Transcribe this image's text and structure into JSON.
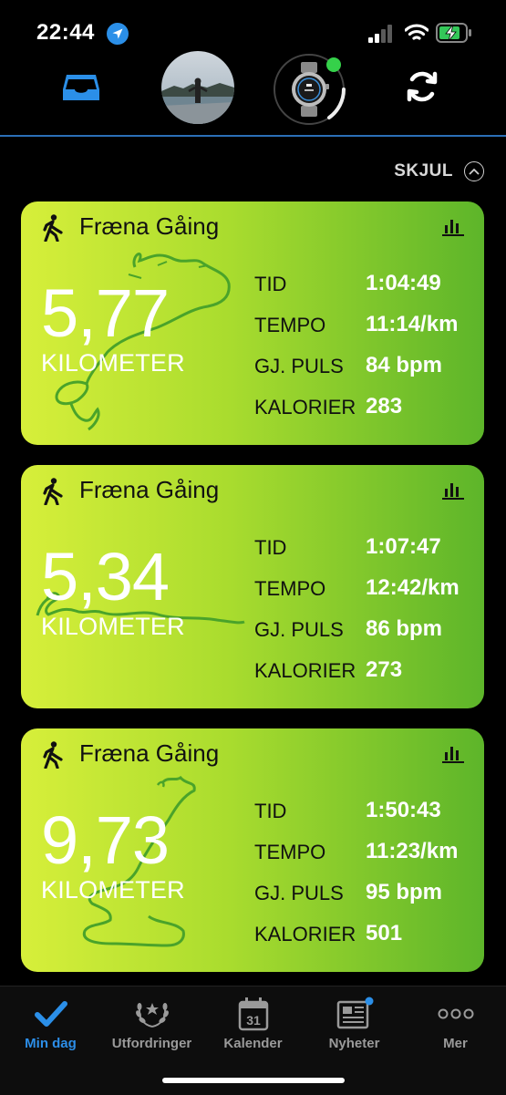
{
  "status_bar": {
    "time": "22:44",
    "battery_color": "#34c759"
  },
  "header": {
    "inbox_icon": "inbox-icon",
    "sync_icon": "sync-icon",
    "accent": "#2b8fe8",
    "watch_status_color": "#35d14a"
  },
  "hide_toggle": {
    "label": "SKJUL"
  },
  "activities": [
    {
      "title": "Fræna Gåing",
      "distance": "5,77",
      "unit": "KILOMETER",
      "stats": [
        {
          "label": "TID",
          "value": "1:04:49"
        },
        {
          "label": "TEMPO",
          "value": "11:14/km"
        },
        {
          "label": "GJ. PULS",
          "value": "84 bpm"
        },
        {
          "label": "KALORIER",
          "value": "283"
        }
      ]
    },
    {
      "title": "Fræna Gåing",
      "distance": "5,34",
      "unit": "KILOMETER",
      "stats": [
        {
          "label": "TID",
          "value": "1:07:47"
        },
        {
          "label": "TEMPO",
          "value": "12:42/km"
        },
        {
          "label": "GJ. PULS",
          "value": "86 bpm"
        },
        {
          "label": "KALORIER",
          "value": "273"
        }
      ]
    },
    {
      "title": "Fræna Gåing",
      "distance": "9,73",
      "unit": "KILOMETER",
      "stats": [
        {
          "label": "TID",
          "value": "1:50:43"
        },
        {
          "label": "TEMPO",
          "value": "11:23/km"
        },
        {
          "label": "GJ. PULS",
          "value": "95 bpm"
        },
        {
          "label": "KALORIER",
          "value": "501"
        }
      ]
    }
  ],
  "tabs": [
    {
      "label": "Min dag",
      "icon": "checkmark-icon",
      "active": true
    },
    {
      "label": "Utfordringer",
      "icon": "laurel-icon",
      "active": false
    },
    {
      "label": "Kalender",
      "icon": "calendar-icon",
      "calendar_day": "31",
      "active": false
    },
    {
      "label": "Nyheter",
      "icon": "newspaper-icon",
      "active": false
    },
    {
      "label": "Mer",
      "icon": "more-icon",
      "active": false
    }
  ]
}
